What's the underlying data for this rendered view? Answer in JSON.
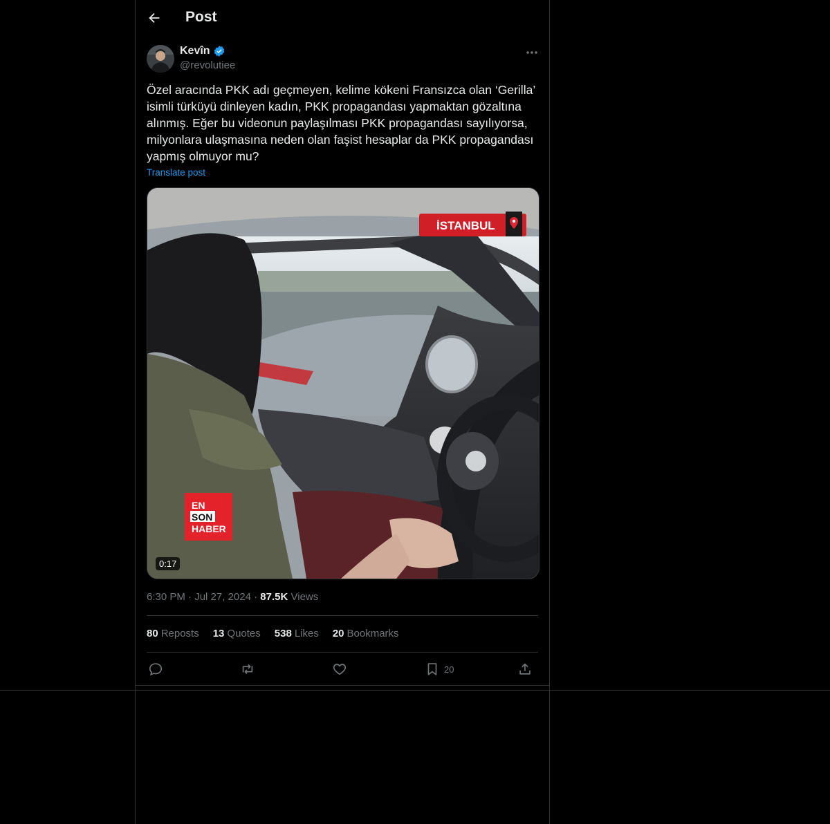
{
  "header": {
    "title": "Post"
  },
  "author": {
    "name": "Kevîn",
    "handle": "@revolutiee",
    "verified": true
  },
  "post": {
    "text": "Özel aracında PKK adı geçmeyen, kelime kökeni Fransızca olan ‘Gerilla’ isimli türküyü dinleyen kadın, PKK propagandası yapmaktan gözaltına alınmış. Eğer bu videonun paylaşılması PKK propagandası sayılıyorsa, milyonlara ulaşmasına neden olan faşist hesaplar da PKK propagandası yapmış olmuyor mu?",
    "translate_label": "Translate post"
  },
  "video": {
    "duration": "0:17",
    "location_badge": "İSTANBUL",
    "logo_lines": [
      "EN",
      "SON",
      "HABER"
    ]
  },
  "meta": {
    "time": "6:30 PM",
    "date": "Jul 27, 2024",
    "views_count": "87.5K",
    "views_label": "Views",
    "dot": "·"
  },
  "stats": [
    {
      "count": "80",
      "label": "Reposts"
    },
    {
      "count": "13",
      "label": "Quotes"
    },
    {
      "count": "538",
      "label": "Likes"
    },
    {
      "count": "20",
      "label": "Bookmarks"
    }
  ],
  "actions": {
    "bookmark_count": "20"
  },
  "colors": {
    "accent": "#1d9bf0",
    "muted": "#71767b",
    "border": "#2f3336",
    "background": "#000000"
  },
  "icons": [
    "back-arrow-icon",
    "verified-badge-icon",
    "more-icon",
    "reply-icon",
    "repost-icon",
    "like-icon",
    "bookmark-icon",
    "share-icon",
    "location-pin-icon"
  ]
}
